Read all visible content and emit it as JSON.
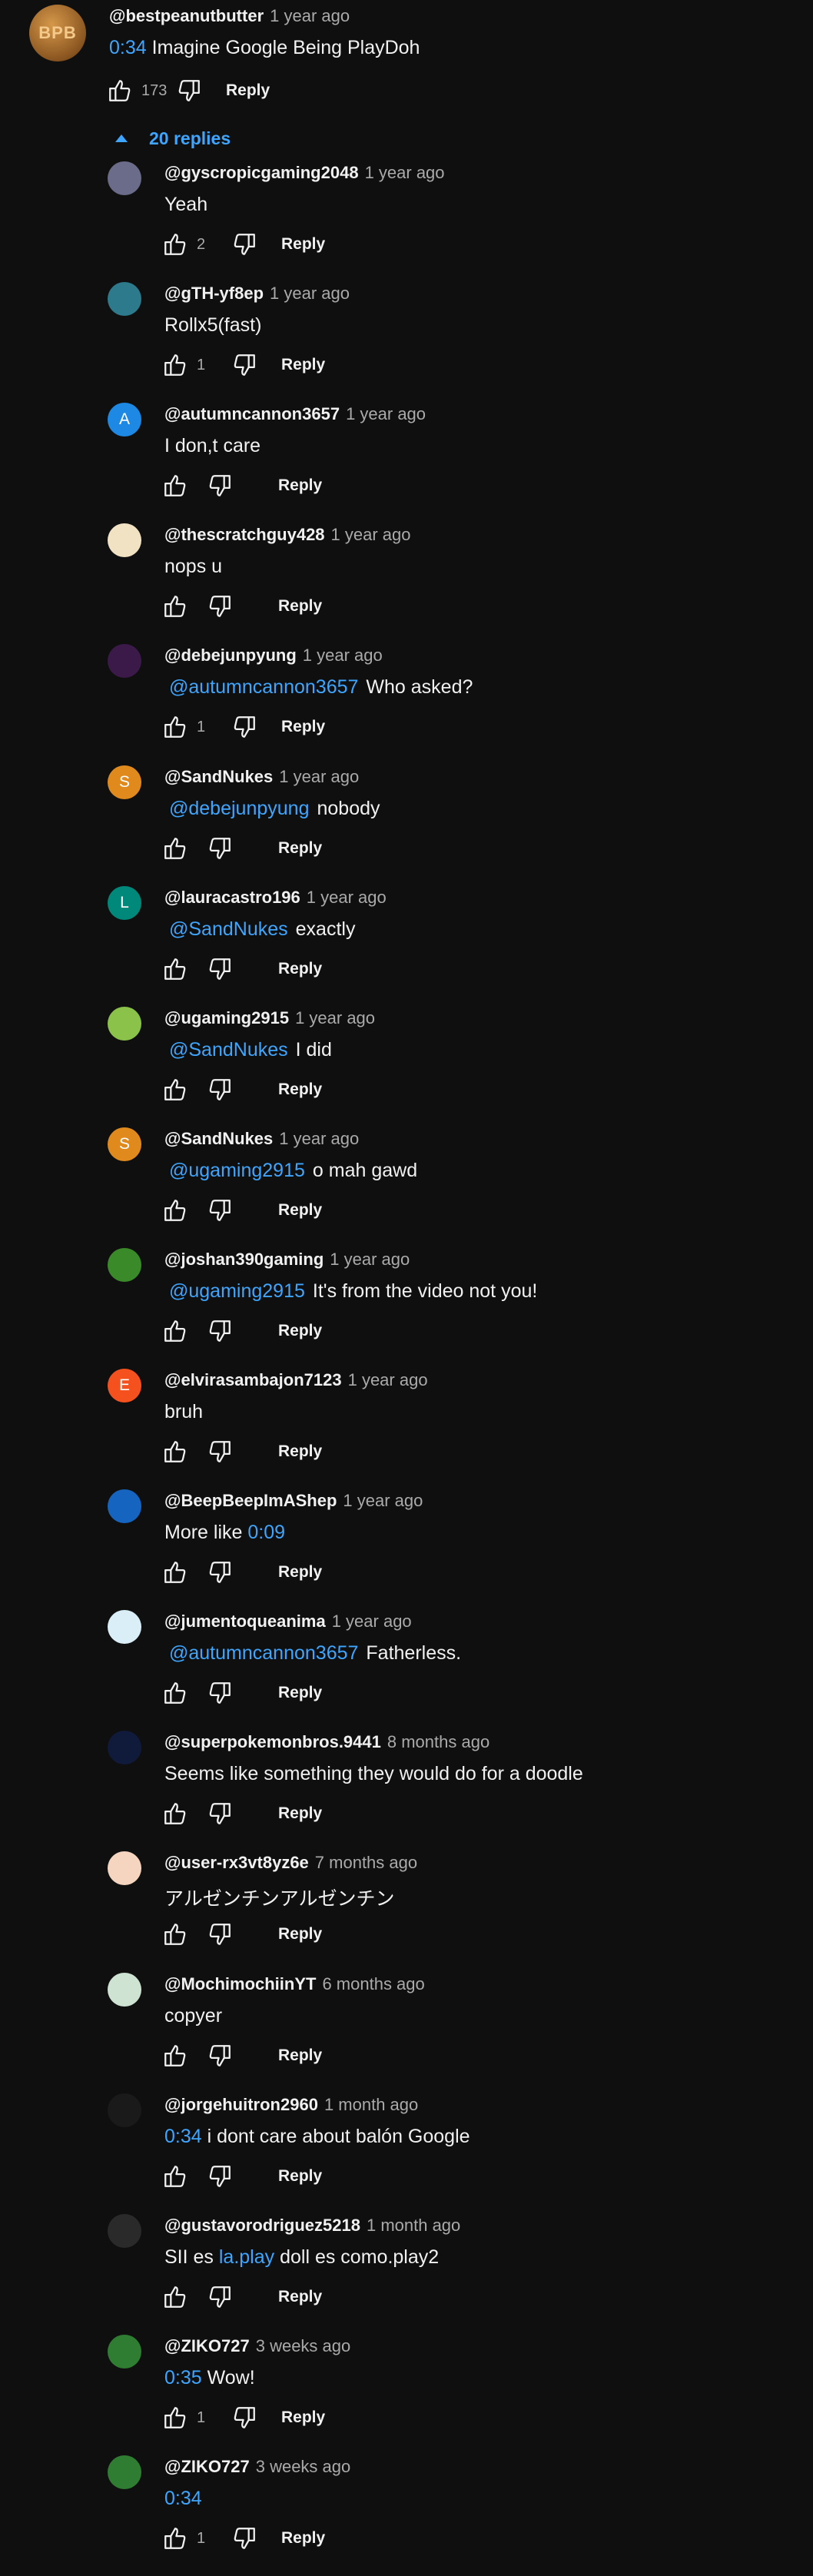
{
  "comment": {
    "avatar_text": "BPB",
    "author": "@bestpeanutbutter",
    "time": "1 year ago",
    "timestamp": "0:34",
    "text": "Imagine Google Being PlayDoh",
    "likes": "173",
    "reply_label": "Reply",
    "replies_toggle": "20 replies"
  },
  "reply_label": "Reply",
  "replies": [
    {
      "author": "@gyscropicgaming2048",
      "time": "1 year ago",
      "text": "Yeah",
      "likes": "2",
      "avatar_color": "#6b6b8a",
      "avatar_text": ""
    },
    {
      "author": "@gTH-yf8ep",
      "time": "1 year ago",
      "text": "Rollx5(fast)",
      "likes": "1",
      "avatar_color": "#2c7a8c",
      "avatar_text": ""
    },
    {
      "author": "@autumncannon3657",
      "time": "1 year ago",
      "text": "I don,t care",
      "likes": "",
      "avatar_color": "#1e88e5",
      "avatar_text": "A"
    },
    {
      "author": "@thescratchguy428",
      "time": "1 year ago",
      "text": "nops u",
      "likes": "",
      "avatar_color": "#f2e2c4",
      "avatar_text": ""
    },
    {
      "author": "@debejunpyung",
      "time": "1 year ago",
      "mention": "@autumncannon3657",
      "text": "Who asked?",
      "likes": "1",
      "avatar_color": "#3b1a4a",
      "avatar_text": ""
    },
    {
      "author": "@SandNukes",
      "time": "1 year ago",
      "mention": "@debejunpyung",
      "text": "nobody",
      "likes": "",
      "avatar_color": "#e08a1e",
      "avatar_text": "S"
    },
    {
      "author": "@lauracastro196",
      "time": "1 year ago",
      "mention": "@SandNukes",
      "text": "exactly",
      "likes": "",
      "avatar_color": "#00897b",
      "avatar_text": "L"
    },
    {
      "author": "@ugaming2915",
      "time": "1 year ago",
      "mention": "@SandNukes",
      "text": "I did",
      "likes": "",
      "avatar_color": "#8bc34a",
      "avatar_text": ""
    },
    {
      "author": "@SandNukes",
      "time": "1 year ago",
      "mention": "@ugaming2915",
      "text": "o mah gawd",
      "likes": "",
      "avatar_color": "#e08a1e",
      "avatar_text": "S"
    },
    {
      "author": "@joshan390gaming",
      "time": "1 year ago",
      "mention": "@ugaming2915",
      "text": "It's from the video not you!",
      "likes": "",
      "avatar_color": "#3a8a2a",
      "avatar_text": ""
    },
    {
      "author": "@elvirasambajon7123",
      "time": "1 year ago",
      "text": "bruh",
      "likes": "",
      "avatar_color": "#f4511e",
      "avatar_text": "E"
    },
    {
      "author": "@BeepBeepImAShep",
      "time": "1 year ago",
      "text": "More like",
      "ts_after": "0:09",
      "likes": "",
      "avatar_color": "#1565c0",
      "avatar_text": ""
    },
    {
      "author": "@jumentoqueanima",
      "time": "1 year ago",
      "mention": "@autumncannon3657",
      "text": "Fatherless.",
      "likes": "",
      "avatar_color": "#d9eef7",
      "avatar_text": ""
    },
    {
      "author": "@superpokemonbros.9441",
      "time": "8 months ago",
      "text": "Seems like something they would do for a doodle",
      "likes": "",
      "avatar_color": "#101a3a",
      "avatar_text": ""
    },
    {
      "author": "@user-rx3vt8yz6e",
      "time": "7 months ago",
      "text": "アルゼンチンアルゼンチン",
      "likes": "",
      "avatar_color": "#f5d5c0",
      "avatar_text": ""
    },
    {
      "author": "@MochimochiinYT",
      "time": "6 months ago",
      "text": "copyer",
      "likes": "",
      "avatar_color": "#cfe3d2",
      "avatar_text": ""
    },
    {
      "author": "@jorgehuitron2960",
      "time": "1 month ago",
      "ts_before": "0:34",
      "text": "i dont care about balón Google",
      "likes": "",
      "avatar_color": "#1a1a1a",
      "avatar_text": ""
    },
    {
      "author": "@gustavorodriguez5218",
      "time": "1 month ago",
      "text_before": "SII es",
      "link": "la.play",
      "text": "doll es como.play2",
      "likes": "",
      "avatar_color": "#2a2a2a",
      "avatar_text": ""
    },
    {
      "author": "@ZIKO727",
      "time": "3 weeks ago",
      "ts_before": "0:35",
      "text": "Wow!",
      "likes": "1",
      "avatar_color": "#2e7d32",
      "avatar_text": ""
    },
    {
      "author": "@ZIKO727",
      "time": "3 weeks ago",
      "ts_before": "0:34",
      "text": "",
      "likes": "1",
      "avatar_color": "#2e7d32",
      "avatar_text": ""
    }
  ]
}
